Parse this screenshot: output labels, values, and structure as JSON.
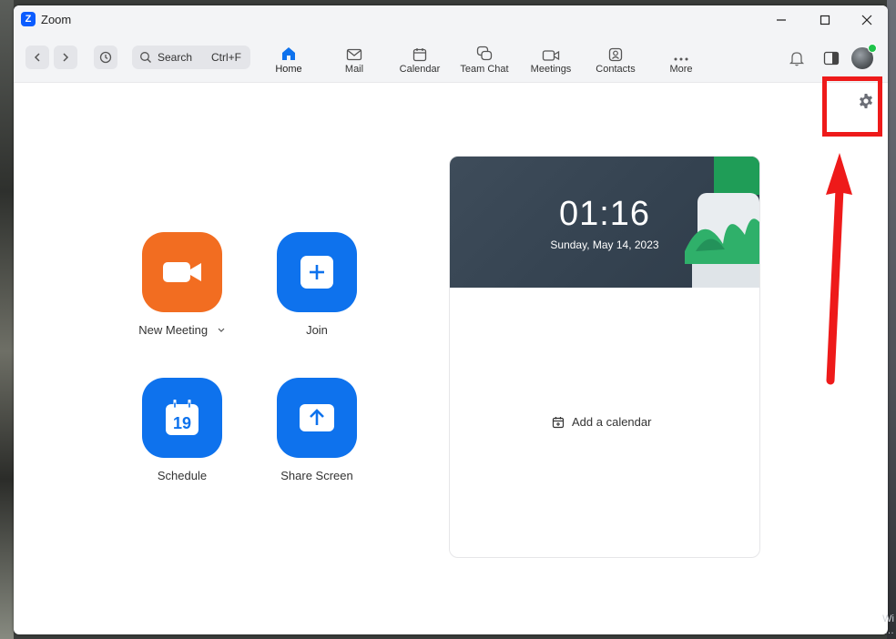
{
  "window": {
    "title": "Zoom"
  },
  "toolbar": {
    "search_label": "Search",
    "search_shortcut": "Ctrl+F",
    "tabs": [
      {
        "label": "Home",
        "icon": "home-icon"
      },
      {
        "label": "Mail",
        "icon": "mail-icon"
      },
      {
        "label": "Calendar",
        "icon": "calendar-icon"
      },
      {
        "label": "Team Chat",
        "icon": "chat-icon"
      },
      {
        "label": "Meetings",
        "icon": "video-icon"
      },
      {
        "label": "Contacts",
        "icon": "contacts-icon"
      },
      {
        "label": "More",
        "icon": "more-icon"
      }
    ]
  },
  "actions": {
    "new_meeting": "New Meeting",
    "join": "Join",
    "schedule": "Schedule",
    "schedule_day": "19",
    "share_screen": "Share Screen"
  },
  "calendar_card": {
    "time": "01:16",
    "date": "Sunday, May 14, 2023",
    "add_calendar": "Add a calendar"
  },
  "colors": {
    "accent": "#0e72ed",
    "new_meeting": "#f26d21",
    "annotation": "#ee1a1a"
  }
}
